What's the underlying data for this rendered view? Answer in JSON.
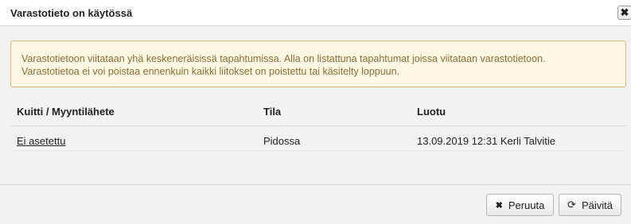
{
  "dialog": {
    "title": "Varastotieto on käytössä",
    "close_icon": "close-icon",
    "close_glyph": "✖"
  },
  "alert": {
    "line1": "Varastotietoon viitataan yhä keskeneräisissä tapahtumissa. Alla on listattuna tapahtumat joissa viitataan varastotietoon.",
    "line2": "Varastotietoa ei voi poistaa ennenkuin kaikki liitokset on poistettu tai käsitelty loppuun.",
    "background": "#fcf8e3",
    "border": "#d7b978",
    "text_color": "#8a6d3b"
  },
  "table": {
    "headers": [
      "Kuitti / Myyntilähete",
      "Tila",
      "Luotu"
    ],
    "rows": [
      {
        "receipt": "Ei asetettu",
        "status": "Pidossa",
        "created": "13.09.2019 12:31 Kerli Talvitie"
      }
    ]
  },
  "footer": {
    "cancel_label": "Peruuta",
    "cancel_icon": "close-icon",
    "cancel_glyph": "✖",
    "refresh_label": "Päivitä",
    "refresh_icon": "refresh-icon",
    "refresh_glyph": "⟳"
  }
}
